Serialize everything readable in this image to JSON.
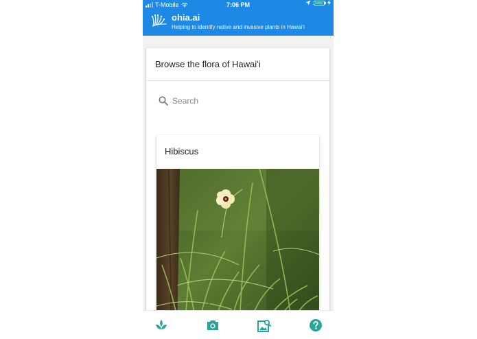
{
  "status_bar": {
    "carrier": "T-Mobile",
    "time": "7:06 PM"
  },
  "app": {
    "title": "ohia.ai",
    "subtitle": "Helping to identify native and invasive plants in Hawaiʻi"
  },
  "browse": {
    "title": "Browse the flora of Hawaiʻi",
    "search_placeholder": "Search"
  },
  "plants": [
    {
      "name": "Hibiscus"
    }
  ],
  "bottom_nav": [
    {
      "icon": "plant-icon"
    },
    {
      "icon": "camera-icon"
    },
    {
      "icon": "image-search-icon"
    },
    {
      "icon": "help-icon"
    }
  ],
  "colors": {
    "header": "#1e88e5",
    "accent": "#26a69a"
  }
}
